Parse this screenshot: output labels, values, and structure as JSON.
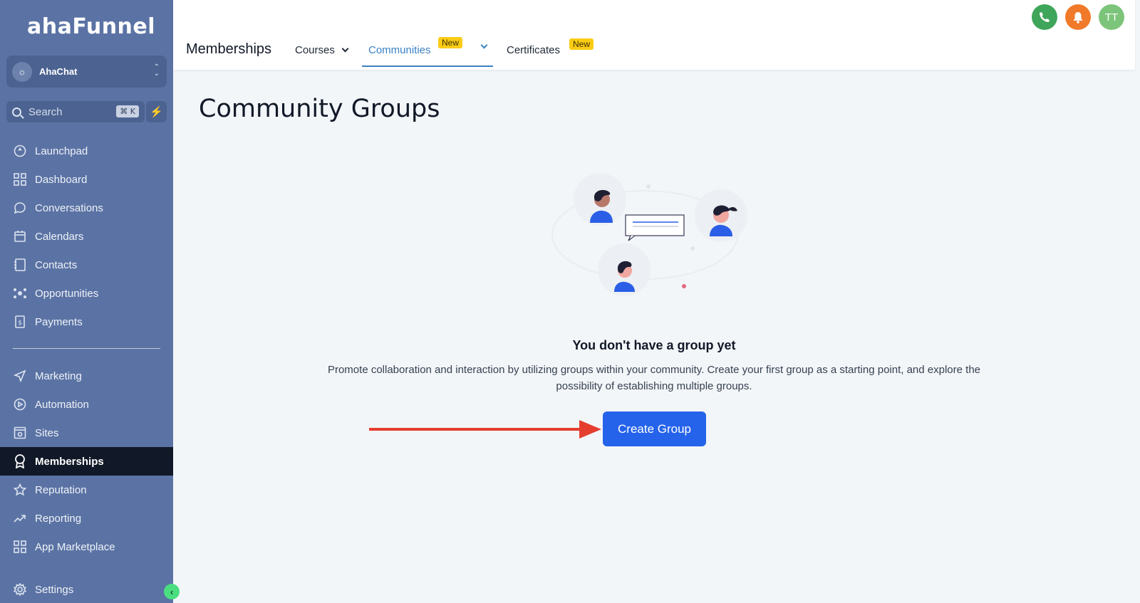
{
  "brand": {
    "logo": "ahaFunnel"
  },
  "account": {
    "name": "AhaChat"
  },
  "search": {
    "placeholder": "Search",
    "shortcut": "⌘ K"
  },
  "sidebar": {
    "items": [
      {
        "label": "Launchpad",
        "icon": "rocket-icon"
      },
      {
        "label": "Dashboard",
        "icon": "grid-icon"
      },
      {
        "label": "Conversations",
        "icon": "chat-icon"
      },
      {
        "label": "Calendars",
        "icon": "calendar-icon"
      },
      {
        "label": "Contacts",
        "icon": "contacts-icon"
      },
      {
        "label": "Opportunities",
        "icon": "opportunities-icon"
      },
      {
        "label": "Payments",
        "icon": "payments-icon"
      },
      {
        "label": "Marketing",
        "icon": "send-icon"
      },
      {
        "label": "Automation",
        "icon": "automation-icon"
      },
      {
        "label": "Sites",
        "icon": "sites-icon"
      },
      {
        "label": "Memberships",
        "icon": "award-icon"
      },
      {
        "label": "Reputation",
        "icon": "star-icon"
      },
      {
        "label": "Reporting",
        "icon": "trend-icon"
      },
      {
        "label": "App Marketplace",
        "icon": "apps-icon"
      },
      {
        "label": "Settings",
        "icon": "gear-icon"
      }
    ],
    "active": "Memberships"
  },
  "header": {
    "section": "Memberships",
    "tabs": [
      {
        "label": "Courses",
        "badge": ""
      },
      {
        "label": "Communities",
        "badge": "New"
      },
      {
        "label": "Certificates",
        "badge": "New"
      }
    ],
    "active_tab": "Communities",
    "user_initials": "TT"
  },
  "main": {
    "title": "Community Groups",
    "empty_title": "You don't have a group yet",
    "empty_desc_line1": "Promote collaboration and interaction by utilizing groups within your community. Create your first group as a starting point, and explore the",
    "empty_desc_line2": "possibility of establishing multiple groups.",
    "create_button": "Create Group"
  },
  "colors": {
    "sidebar_bg": "#5b73a4",
    "active_item_bg": "#111827",
    "primary": "#2563eb",
    "tab_active": "#3b82c4",
    "badge": "#facc15",
    "arrow": "#e53e2e"
  }
}
